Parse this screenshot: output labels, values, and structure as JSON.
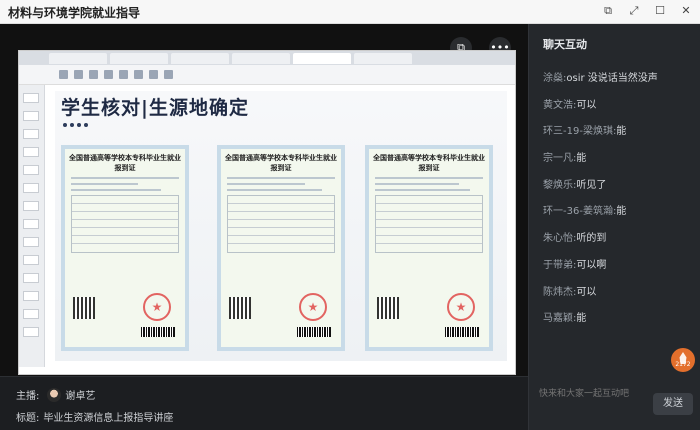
{
  "window": {
    "title": "材料与环境学院就业指导"
  },
  "video": {
    "slide": {
      "title": "学生核对|生源地确定",
      "cards": [
        {
          "title": "全国普通高等学校本专科毕业生就业报到证"
        },
        {
          "title": "全国普通高等学校本专科毕业生就业报到证"
        },
        {
          "title": "全国普通高等学校本专科毕业生就业报到证"
        }
      ]
    }
  },
  "info": {
    "host_label": "主播:",
    "host_name": "谢卓艺",
    "topic_label": "标题:",
    "topic": "毕业生资源信息上报指导讲座"
  },
  "chat": {
    "header": "聊天互动",
    "messages": [
      {
        "name": "涂燊",
        "sep": ":",
        "text": "osir 没说话当然没声"
      },
      {
        "name": "黄文浩",
        "sep": ":",
        "text": "可以"
      },
      {
        "name": "环三-19-梁焕琪",
        "sep": ":",
        "text": "能"
      },
      {
        "name": "宗一凡",
        "sep": ":",
        "text": "能"
      },
      {
        "name": "黎焕乐",
        "sep": ":",
        "text": "听见了"
      },
      {
        "name": "环一-36-姜筑瀚",
        "sep": ":",
        "text": "能"
      },
      {
        "name": "朱心怡",
        "sep": ":",
        "text": "听的到"
      },
      {
        "name": "于带弟",
        "sep": ":",
        "text": "可以啊"
      },
      {
        "name": "陈炜杰",
        "sep": ":",
        "text": "可以"
      },
      {
        "name": "马嘉颖",
        "sep": ":",
        "text": "能"
      }
    ],
    "like_count": "2172",
    "input_placeholder": "快来和大家一起互动吧",
    "send_label": "发送"
  }
}
